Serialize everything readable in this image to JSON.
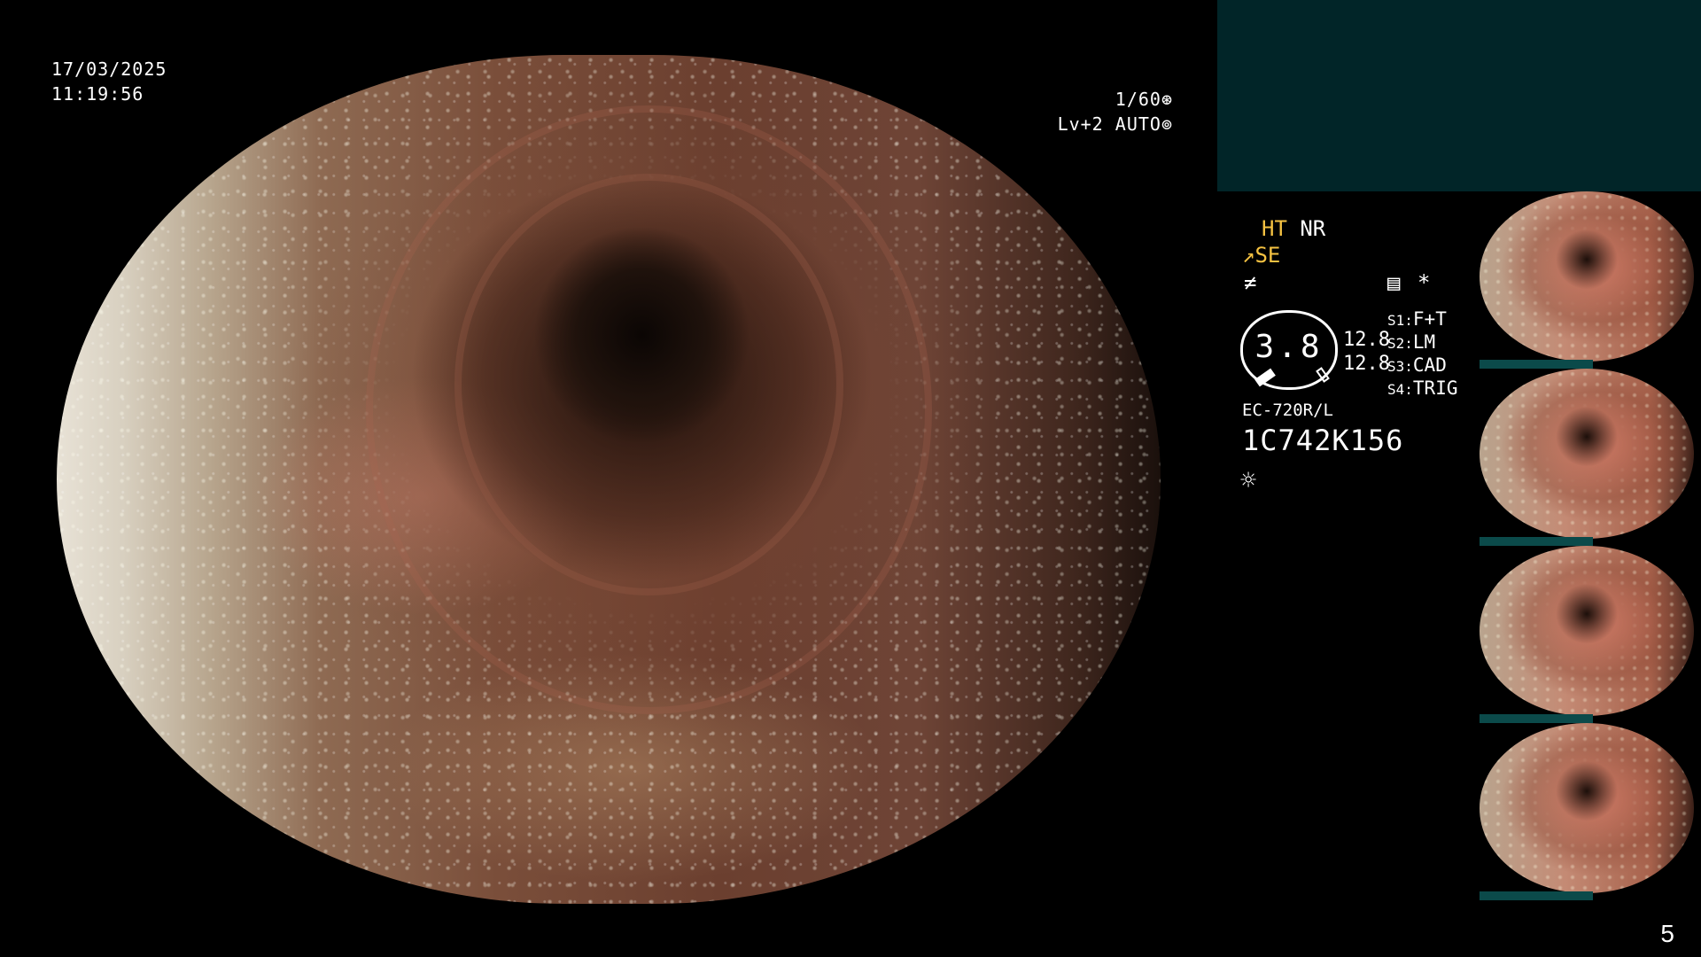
{
  "datetime": {
    "date": "17/03/2025",
    "time": "11:19:56"
  },
  "exposure": {
    "shutter": "1/60",
    "shutter_icon": "aperture-icon",
    "level": "Lv+2",
    "mode": "AUTO",
    "mode_icon": "iris-icon"
  },
  "modes": {
    "ht": "HT",
    "nr": "NR",
    "se": "SE",
    "se_icon": "enhance-icon",
    "fm_icon": "function-icon",
    "record_icon": "memory-card-icon",
    "star": "*"
  },
  "tip": {
    "value": "3.8",
    "left_val": "12.8",
    "right_val": "12.8"
  },
  "switches": [
    {
      "key": "S1",
      "sep": ":",
      "value": "F+T"
    },
    {
      "key": "S2",
      "sep": ":",
      "value": "LM"
    },
    {
      "key": "S3",
      "sep": ":",
      "value": "CAD"
    },
    {
      "key": "S4",
      "sep": ":",
      "value": "TRIG"
    }
  ],
  "scope": {
    "model": "EC-720R/L",
    "serial": "1C742K156",
    "light_icon": "light-source-icon"
  },
  "thumbnails": {
    "count": 4
  },
  "page_number": "5",
  "colors": {
    "accent_yellow": "#f5c242",
    "banner": "#012528",
    "thumb_bar": "#0b4a4a"
  }
}
